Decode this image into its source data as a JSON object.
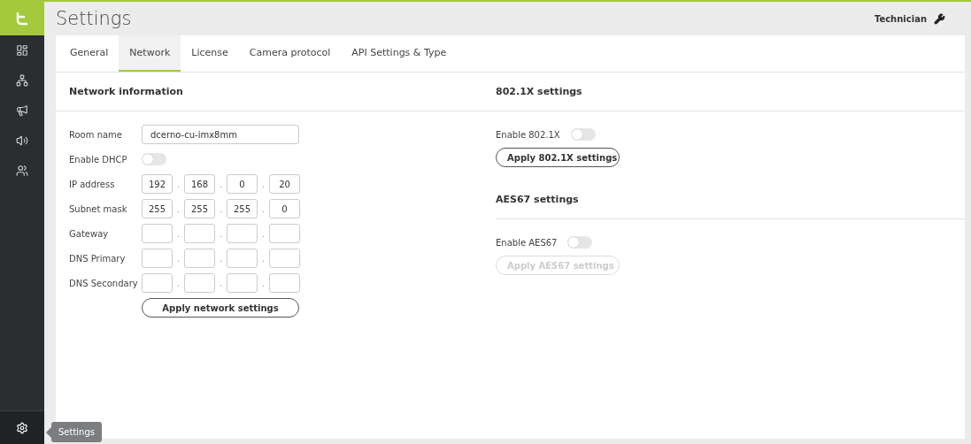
{
  "sidebar": {
    "items": [
      {
        "selected": false
      },
      {
        "selected": false
      },
      {
        "selected": false
      },
      {
        "selected": false
      },
      {
        "selected": false
      }
    ],
    "footer_item": {
      "selected": true,
      "tooltip": "Settings"
    }
  },
  "header": {
    "title": "Settings",
    "user": "Technician"
  },
  "tabs": [
    {
      "label": "General",
      "selected": false
    },
    {
      "label": "Network",
      "selected": true
    },
    {
      "label": "License",
      "selected": false
    },
    {
      "label": "Camera protocol",
      "selected": false
    },
    {
      "label": "API Settings & Type",
      "selected": false
    }
  ],
  "network_information": {
    "title": "Network information",
    "rows": [
      {
        "kind": "text",
        "label": "Room name",
        "value": "dcerno-cu-imx8mm"
      },
      {
        "kind": "toggle",
        "label": "Enable DHCP",
        "on": false
      },
      {
        "kind": "ip",
        "label": "IP address",
        "octets": [
          "192",
          "168",
          "0",
          "20"
        ],
        "separators": [
          ".",
          ".",
          "."
        ]
      },
      {
        "kind": "ip",
        "label": "Subnet mask",
        "octets": [
          "255",
          "255",
          "255",
          "0"
        ],
        "separators": [
          ".",
          ".",
          "."
        ]
      },
      {
        "kind": "ip",
        "label": "Gateway",
        "separators": [
          ".",
          ".",
          "."
        ]
      },
      {
        "kind": "ip",
        "label": "DNS Primary",
        "separators": [
          ".",
          ".",
          "."
        ]
      },
      {
        "kind": "ip",
        "label": "DNS Secondary",
        "separators": [
          ".",
          ".",
          "."
        ]
      }
    ],
    "button": {
      "label": "Apply network settings",
      "disabled": false
    }
  },
  "sections": [
    {
      "title": "802.1X settings",
      "toggle": {
        "label": "Enable 802.1X",
        "on": false
      },
      "button": {
        "label": "Apply 802.1X settings",
        "disabled": false
      }
    },
    {
      "title": "AES67 settings",
      "toggle": {
        "label": "Enable AES67",
        "on": false
      },
      "button": {
        "label": "Apply AES67 settings",
        "disabled": true
      }
    }
  ]
}
